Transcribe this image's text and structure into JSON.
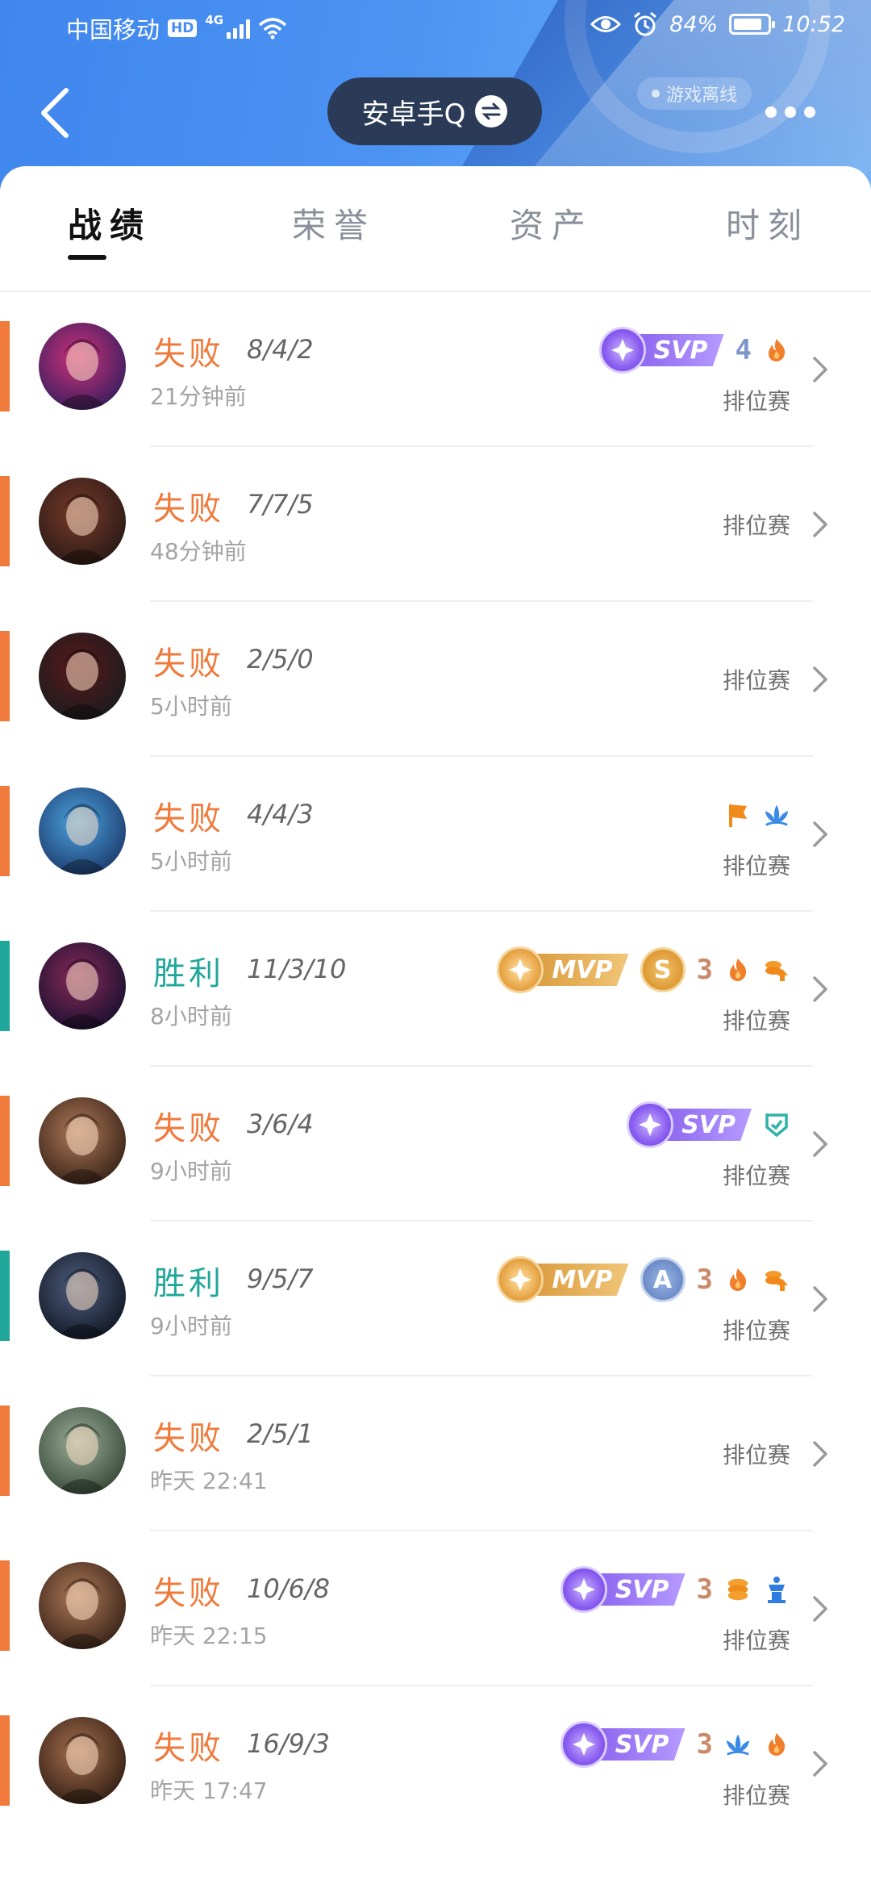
{
  "status_bar": {
    "carrier": "中国移动",
    "hd": "HD",
    "network": "4G",
    "battery_text": "84%",
    "battery_level": 0.84,
    "time": "10:52"
  },
  "header": {
    "title": "安卓手Q",
    "offline_tag": "游戏离线"
  },
  "tabs": [
    {
      "label": "战绩",
      "active": true
    },
    {
      "label": "荣誉",
      "active": false
    },
    {
      "label": "资产",
      "active": false
    },
    {
      "label": "时刻",
      "active": false
    }
  ],
  "matches": [
    {
      "result": "失败",
      "outcome": "lose",
      "kda": "8/4/2",
      "time": "21分钟前",
      "mode": "排位赛",
      "honor": "SVP",
      "grade": "",
      "streak": "4",
      "icons": [
        "flame-icon"
      ]
    },
    {
      "result": "失败",
      "outcome": "lose",
      "kda": "7/7/5",
      "time": "48分钟前",
      "mode": "排位赛",
      "honor": "",
      "grade": "",
      "streak": "",
      "icons": []
    },
    {
      "result": "失败",
      "outcome": "lose",
      "kda": "2/5/0",
      "time": "5小时前",
      "mode": "排位赛",
      "honor": "",
      "grade": "",
      "streak": "",
      "icons": []
    },
    {
      "result": "失败",
      "outcome": "lose",
      "kda": "4/4/3",
      "time": "5小时前",
      "mode": "排位赛",
      "honor": "",
      "grade": "",
      "streak": "",
      "icons": [
        "flag-icon",
        "lotus-icon"
      ]
    },
    {
      "result": "胜利",
      "outcome": "win",
      "kda": "11/3/10",
      "time": "8小时前",
      "mode": "排位赛",
      "honor": "MVP",
      "grade": "S",
      "streak": "3",
      "icons": [
        "flame-icon",
        "coin-up-icon"
      ]
    },
    {
      "result": "失败",
      "outcome": "lose",
      "kda": "3/6/4",
      "time": "9小时前",
      "mode": "排位赛",
      "honor": "SVP",
      "grade": "",
      "streak": "",
      "icons": [
        "shield-icon"
      ]
    },
    {
      "result": "胜利",
      "outcome": "win",
      "kda": "9/5/7",
      "time": "9小时前",
      "mode": "排位赛",
      "honor": "MVP",
      "grade": "A",
      "streak": "3",
      "icons": [
        "flame-icon",
        "coin-up-icon"
      ]
    },
    {
      "result": "失败",
      "outcome": "lose",
      "kda": "2/5/1",
      "time": "昨天 22:41",
      "mode": "排位赛",
      "honor": "",
      "grade": "",
      "streak": "",
      "icons": []
    },
    {
      "result": "失败",
      "outcome": "lose",
      "kda": "10/6/8",
      "time": "昨天 22:15",
      "mode": "排位赛",
      "honor": "SVP",
      "grade": "",
      "streak": "3",
      "icons": [
        "coins-icon",
        "tower-icon"
      ]
    },
    {
      "result": "失败",
      "outcome": "lose",
      "kda": "16/9/3",
      "time": "昨天 17:47",
      "mode": "排位赛",
      "honor": "SVP",
      "grade": "",
      "streak": "3",
      "icons": [
        "lotus-icon",
        "flame-icon"
      ]
    }
  ],
  "colors": {
    "lose": "#ef7a3b",
    "win": "#20a79a",
    "header_blue": "#4c93f2",
    "pill": "#2b3b57"
  },
  "avatars": [
    {
      "name": "avatar-hero-1",
      "c1": "#d0317a",
      "c2": "#3a1f5e"
    },
    {
      "name": "avatar-hero-2",
      "c1": "#7a3b2a",
      "c2": "#2a1a16"
    },
    {
      "name": "avatar-hero-3",
      "c1": "#5a1a1a",
      "c2": "#1b1b1f"
    },
    {
      "name": "avatar-hero-4",
      "c1": "#4aa5e0",
      "c2": "#1e3c6e"
    },
    {
      "name": "avatar-hero-5",
      "c1": "#8a2a5a",
      "c2": "#1a1030"
    },
    {
      "name": "avatar-hero-6",
      "c1": "#b07a5a",
      "c2": "#3a2418"
    },
    {
      "name": "avatar-hero-7",
      "c1": "#506080",
      "c2": "#121826"
    },
    {
      "name": "avatar-hero-8",
      "c1": "#9ab09a",
      "c2": "#3a4a3a"
    },
    {
      "name": "avatar-hero-9",
      "c1": "#b07a5a",
      "c2": "#3a2418"
    },
    {
      "name": "avatar-hero-10",
      "c1": "#a87050",
      "c2": "#342014"
    }
  ]
}
